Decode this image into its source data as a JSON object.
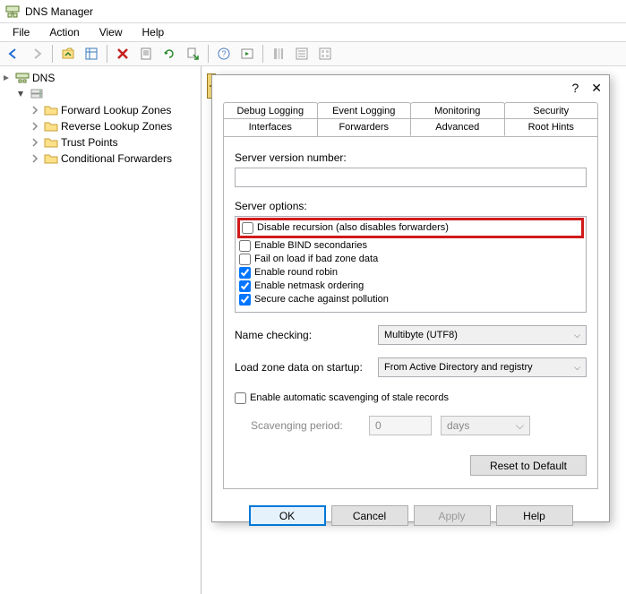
{
  "window": {
    "title": "DNS Manager"
  },
  "menu": {
    "file": "File",
    "action": "Action",
    "view": "View",
    "help": "Help"
  },
  "tree": {
    "root": "DNS",
    "items": [
      "Forward Lookup Zones",
      "Reverse Lookup Zones",
      "Trust Points",
      "Conditional Forwarders"
    ]
  },
  "dialog": {
    "tabs_row1": [
      "Debug Logging",
      "Event Logging",
      "Monitoring",
      "Security"
    ],
    "tabs_row2": [
      "Interfaces",
      "Forwarders",
      "Advanced",
      "Root Hints"
    ],
    "active_tab": "Advanced",
    "server_version_label": "Server version number:",
    "server_version_value": "",
    "server_options_label": "Server options:",
    "options": [
      {
        "label": "Disable recursion (also disables forwarders)",
        "checked": false,
        "highlight": true
      },
      {
        "label": "Enable BIND secondaries",
        "checked": false
      },
      {
        "label": "Fail on load if bad zone data",
        "checked": false
      },
      {
        "label": "Enable round robin",
        "checked": true
      },
      {
        "label": "Enable netmask ordering",
        "checked": true
      },
      {
        "label": "Secure cache against pollution",
        "checked": true
      }
    ],
    "name_checking_label": "Name checking:",
    "name_checking_value": "Multibyte (UTF8)",
    "load_zone_label": "Load zone data on startup:",
    "load_zone_value": "From Active Directory and registry",
    "scavenging_checkbox": "Enable automatic scavenging of stale records",
    "scavenging_checked": false,
    "scavenging_period_label": "Scavenging period:",
    "scavenging_period_value": "0",
    "scavenging_unit": "days",
    "reset_label": "Reset to Default",
    "buttons": {
      "ok": "OK",
      "cancel": "Cancel",
      "apply": "Apply",
      "help": "Help"
    }
  }
}
